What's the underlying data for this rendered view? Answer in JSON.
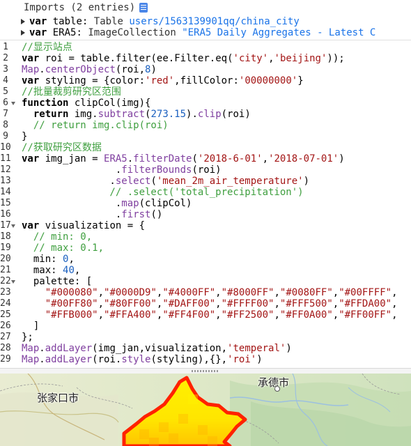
{
  "imports": {
    "title": "Imports (2 entries)",
    "entries": [
      {
        "keyword": "var",
        "name": "table",
        "colon": ":",
        "type": "Table",
        "value": "users/1563139901qq/china_city"
      },
      {
        "keyword": "var",
        "name": "ERA5",
        "colon": ":",
        "type": "ImageCollection",
        "value": "\"ERA5 Daily Aggregates - Latest C"
      }
    ]
  },
  "editor": {
    "line_numbers": [
      "1",
      "2",
      "3",
      "4",
      "5",
      "6",
      "7",
      "8",
      "9",
      "10",
      "11",
      "12",
      "13",
      "14",
      "15",
      "16",
      "17",
      "18",
      "19",
      "20",
      "21",
      "22",
      "23",
      "24",
      "25",
      "26",
      "27",
      "28",
      "29"
    ]
  },
  "map": {
    "labels": [
      "张家口市",
      "承德市"
    ],
    "colors": {
      "polygon_border": "#ff2200",
      "polygon_fill": "#ffd400"
    }
  }
}
